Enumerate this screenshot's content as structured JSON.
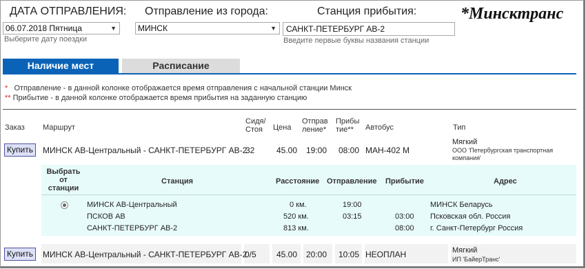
{
  "header": {
    "date_title": "ДАТА ОТПРАВЛЕНИЯ:",
    "from_title": "Отправление из города:",
    "to_title": "Станция прибытия:",
    "logo": "*Минсктранс"
  },
  "form": {
    "date_value": "06.07.2018 Пятница",
    "date_hint": "Выберите дату поездки",
    "from_value": "МИНСК",
    "to_value": "САНКТ-ПЕТЕРБУРГ АВ-2",
    "to_hint": "Введите первые буквы названия станции"
  },
  "tabs": [
    {
      "label": "Наличие мест",
      "active": true
    },
    {
      "label": "Расписание",
      "active": false
    }
  ],
  "notes": {
    "n1_star": "*",
    "n1_text": "Отправление - в данной колонке отображается время отправления с начальной станции Минск",
    "n2_star": "**",
    "n2_text": "Прибытие - в данной колонке отображается время прибытия на заданную станцию"
  },
  "table": {
    "headers": {
      "order": "Заказ",
      "route": "Маршрут",
      "seats_1": "Сидя/",
      "seats_2": "Стоя",
      "price": "Цена",
      "dep_1": "Отправ",
      "dep_2": "ление*",
      "arr_1": "Прибы",
      "arr_2": "тие**",
      "bus": "Автобус",
      "type": "Тип"
    },
    "rows": [
      {
        "buy": "Купить",
        "route": "МИНСК АВ-Центральный - САНКТ-ПЕТЕРБУРГ АВ-2",
        "seats": "32",
        "price": "45.00",
        "departure": "19:00",
        "arrival": "08:00",
        "bus": "МАН-402 М",
        "type": "Мягкий",
        "carrier": "ООО 'Петербургская транспортная компания'"
      },
      {
        "buy": "Купить",
        "route": "МИНСК АВ-Центральный - САНКТ-ПЕТЕРБУРГ АВ-2",
        "seats": "0/5",
        "price": "45.00",
        "departure": "20:00",
        "arrival": "10:05",
        "bus": "НЕОПЛАН",
        "type": "Мягкий",
        "carrier": "ИП 'БайерТранс'"
      }
    ]
  },
  "stations": {
    "headers": {
      "choose_1": "Выбрать",
      "choose_2": "от",
      "choose_3": "станции",
      "station": "Станция",
      "distance": "Расстояние",
      "departure": "Отправление",
      "arrival": "Прибытие",
      "address": "Адрес"
    },
    "rows": [
      {
        "station": "МИНСК АВ-Центральный",
        "distance": "0 км.",
        "departure": "19:00",
        "arrival": "",
        "address": "МИНСК Беларусь",
        "selected": true
      },
      {
        "station": "ПСКОВ АВ",
        "distance": "520 км.",
        "departure": "03:15",
        "arrival": "03:00",
        "address": "Псковская обл. Россия",
        "selected": false
      },
      {
        "station": "САНКТ-ПЕТЕРБУРГ АВ-2",
        "distance": "813 км.",
        "departure": "",
        "arrival": "08:00",
        "address": "г. Санкт-Петербург Россия",
        "selected": false
      }
    ]
  }
}
